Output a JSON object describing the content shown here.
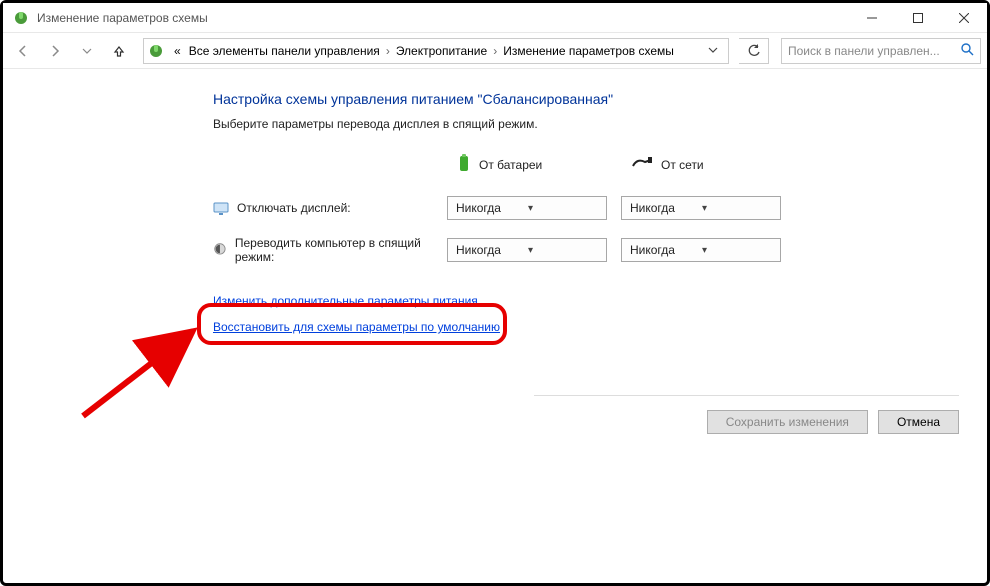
{
  "window": {
    "title": "Изменение параметров схемы"
  },
  "breadcrumb": {
    "prefix": "«",
    "items": [
      "Все элементы панели управления",
      "Электропитание",
      "Изменение параметров схемы"
    ]
  },
  "search": {
    "placeholder": "Поиск в панели управлен..."
  },
  "main": {
    "heading": "Настройка схемы управления питанием \"Сбалансированная\"",
    "subheading": "Выберите параметры перевода дисплея в спящий режим.",
    "columns": {
      "battery": "От батареи",
      "ac": "От сети"
    },
    "rows": {
      "display": {
        "label": "Отключать дисплей:",
        "battery": "Никогда",
        "ac": "Никогда"
      },
      "sleep": {
        "label": "Переводить компьютер в спящий режим:",
        "battery": "Никогда",
        "ac": "Никогда"
      }
    },
    "links": {
      "advanced": "Изменить дополнительные параметры питания",
      "restore": "Восстановить для схемы параметры по умолчанию"
    },
    "buttons": {
      "save": "Сохранить изменения",
      "cancel": "Отмена"
    }
  }
}
